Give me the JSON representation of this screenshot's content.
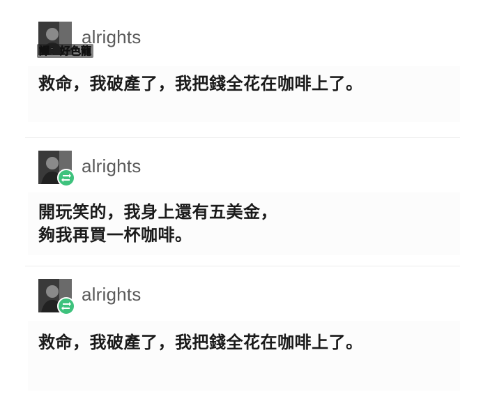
{
  "watermark": {
    "translator_label": "譯：好色龍"
  },
  "posts": [
    {
      "username": "alrights",
      "text": "救命，我破產了，我把錢全花在咖啡上了。",
      "avatar_icon": "user-avatar",
      "reblogged": false
    },
    {
      "username": "alrights",
      "text": "開玩笑的，我身上還有五美金，\n夠我再買一杯咖啡。",
      "avatar_icon": "user-avatar",
      "badge_icon": "reblog-icon",
      "reblogged": true
    },
    {
      "username": "alrights",
      "text": "救命，我破產了，我把錢全花在咖啡上了。",
      "avatar_icon": "user-avatar",
      "badge_icon": "reblog-icon",
      "reblogged": true
    }
  ],
  "colors": {
    "reblog_badge": "#3ec27d",
    "username": "#5a5a5a",
    "text": "#1a1a1a",
    "divider": "#ececec"
  }
}
